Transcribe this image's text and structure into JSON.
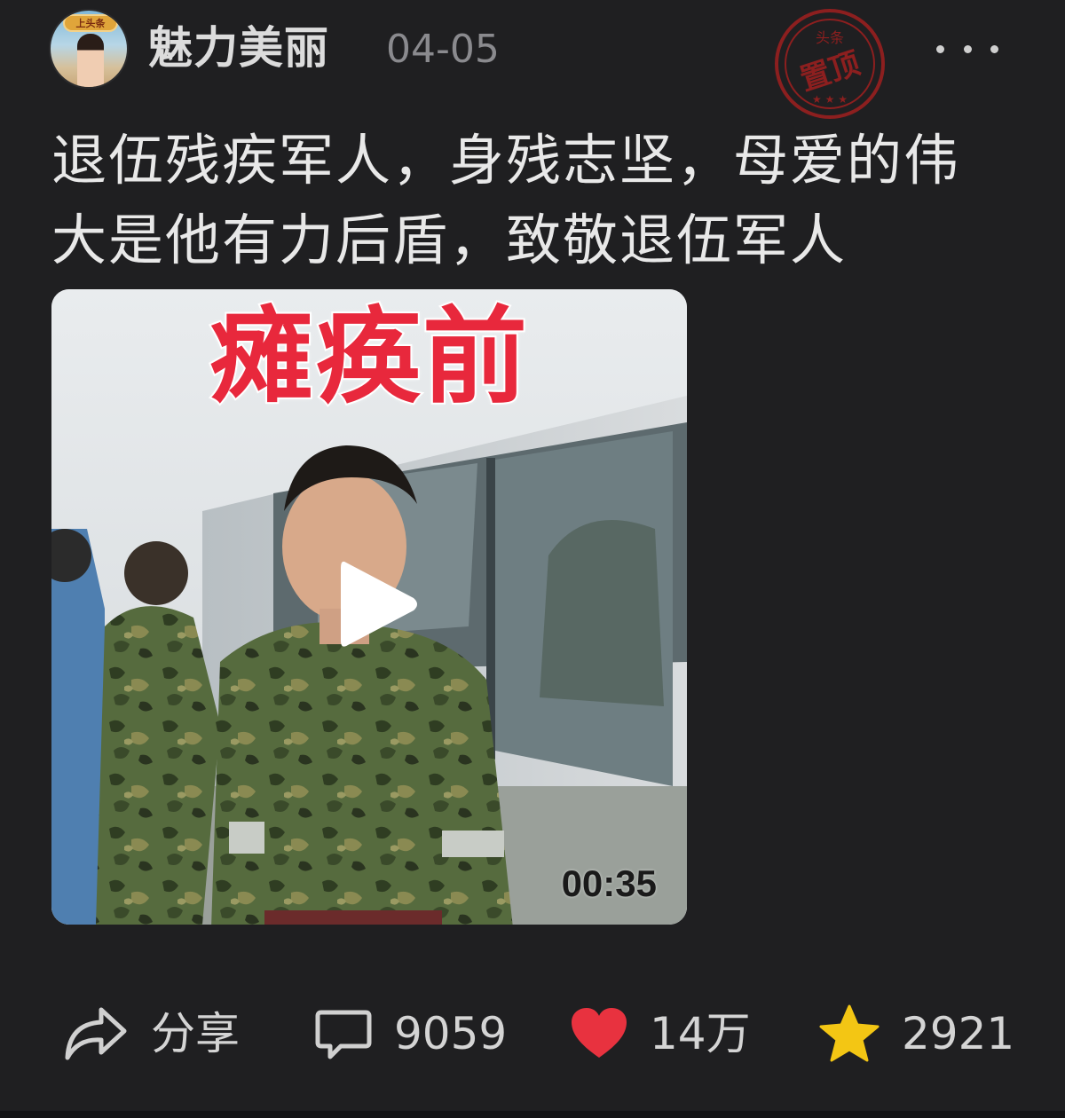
{
  "header": {
    "avatar_badge": "上头条",
    "username": "魅力美丽",
    "date": "04-05",
    "pin_stamp": {
      "top_text": "头条",
      "main_text": "置顶"
    }
  },
  "post": {
    "text": "退伍残疾军人，身残志坚，母爱的伟大是他有力后盾，致敬退伍军人"
  },
  "video": {
    "overlay_title": "瘫痪前",
    "duration": "00:35"
  },
  "actions": {
    "share_label": "分享",
    "comment_count": "9059",
    "like_count": "14万",
    "favorite_count": "2921"
  },
  "colors": {
    "background": "#1f1f21",
    "like": "#e8323f",
    "favorite": "#f3c614",
    "stamp": "#8c1f1f",
    "overlay_title": "#e8283c"
  },
  "icons": {
    "more": "more-dots-icon",
    "share": "share-arrow-icon",
    "comment": "comment-bubble-icon",
    "like": "heart-icon",
    "favorite": "star-icon",
    "play": "play-icon"
  }
}
